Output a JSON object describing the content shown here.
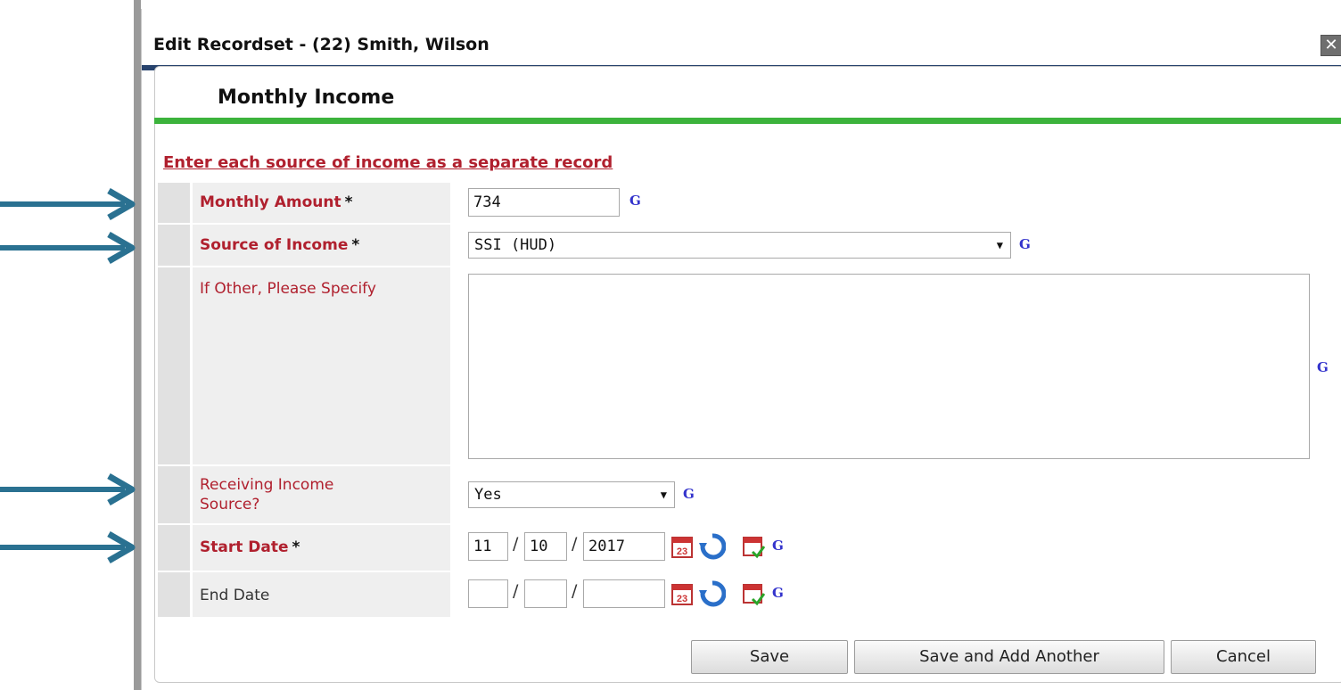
{
  "dialog": {
    "title": "Edit Recordset - (22) Smith, Wilson",
    "close_icon": "close-icon"
  },
  "form": {
    "section_title": "Monthly Income",
    "instruction": "Enter each source of income as a separate record",
    "required_mark": "*",
    "g_label": "G",
    "fields": {
      "monthly_amount": {
        "label": "Monthly Amount",
        "value": "734"
      },
      "source_of_income": {
        "label": "Source of Income",
        "value": "SSI (HUD)"
      },
      "if_other": {
        "label": "If Other, Please Specify",
        "value": ""
      },
      "receiving_income": {
        "label": "Receiving Income Source?",
        "value": "Yes"
      },
      "start_date": {
        "label": "Start Date",
        "month": "11",
        "day": "10",
        "year": "2017"
      },
      "end_date": {
        "label": "End Date",
        "month": "",
        "day": "",
        "year": ""
      }
    },
    "date_separator": "/"
  },
  "buttons": {
    "save": "Save",
    "save_add": "Save and Add Another",
    "cancel": "Cancel"
  },
  "colors": {
    "label_red": "#b0202e",
    "title_rule": "#27436d",
    "section_rule": "#3cb33c",
    "arrow": "#2a7191"
  },
  "icons": [
    "calendar-icon",
    "reset-icon",
    "calendar-check-icon",
    "arrow-right-icon"
  ]
}
